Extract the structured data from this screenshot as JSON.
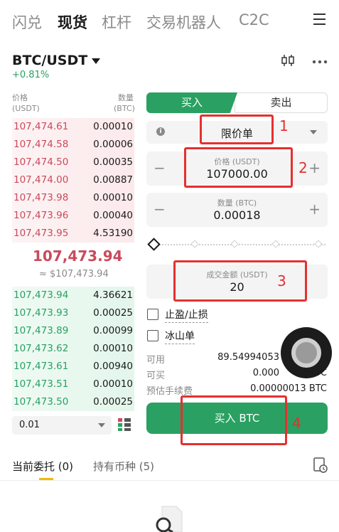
{
  "top_tabs": [
    "闪兑",
    "现货",
    "杠杆",
    "交易机器人",
    "C2C"
  ],
  "active_tab": "现货",
  "pair": {
    "symbol": "BTC/USDT",
    "change": "+0.81%"
  },
  "order_book": {
    "price_header": [
      "价格",
      "(USDT)"
    ],
    "qty_header": [
      "数量",
      "(BTC)"
    ],
    "asks": [
      {
        "price": "107,474.61",
        "qty": "0.00010"
      },
      {
        "price": "107,474.58",
        "qty": "0.00006"
      },
      {
        "price": "107,474.50",
        "qty": "0.00035"
      },
      {
        "price": "107,474.00",
        "qty": "0.00887"
      },
      {
        "price": "107,473.98",
        "qty": "0.00010"
      },
      {
        "price": "107,473.96",
        "qty": "0.00040"
      },
      {
        "price": "107,473.95",
        "qty": "4.53190"
      }
    ],
    "mid_price": "107,473.94",
    "mid_fiat": "≈ $107,473.94",
    "bids": [
      {
        "price": "107,473.94",
        "qty": "4.36621"
      },
      {
        "price": "107,473.93",
        "qty": "0.00025"
      },
      {
        "price": "107,473.89",
        "qty": "0.00099"
      },
      {
        "price": "107,473.62",
        "qty": "0.00010"
      },
      {
        "price": "107,473.61",
        "qty": "0.00940"
      },
      {
        "price": "107,473.51",
        "qty": "0.00010"
      },
      {
        "price": "107,473.50",
        "qty": "0.00025"
      }
    ],
    "depth": "0.01"
  },
  "trade": {
    "buy_tab": "买入",
    "sell_tab": "卖出",
    "order_type": "限价单",
    "price_label": "价格 (USDT)",
    "price_value": "107000.00",
    "qty_label": "数量 (BTC)",
    "qty_value": "0.00018",
    "amount_label": "成交金额 (USDT)",
    "amount_value": "20",
    "tp_sl": "止盈/止损",
    "iceberg": "冰山单",
    "available_key": "可用",
    "available_val": "89.54994053",
    "buyable_key": "可买",
    "buyable_val": "0.000",
    "buyable_tail": "BTC",
    "fee_key": "预估手续费",
    "fee_val": "0.00000013 BTC",
    "buy_button": "买入 BTC",
    "minus": "−",
    "plus": "+",
    "info": "i"
  },
  "bottom_tabs": {
    "open_orders": "当前委托 (0)",
    "holdings": "持有币种 (5)"
  },
  "annotations": [
    "1",
    "2",
    "3",
    "4"
  ],
  "colors": {
    "green": "#2aa062",
    "red": "#c94a5c",
    "annotation": "#e53030",
    "accent": "#f0b90b"
  }
}
